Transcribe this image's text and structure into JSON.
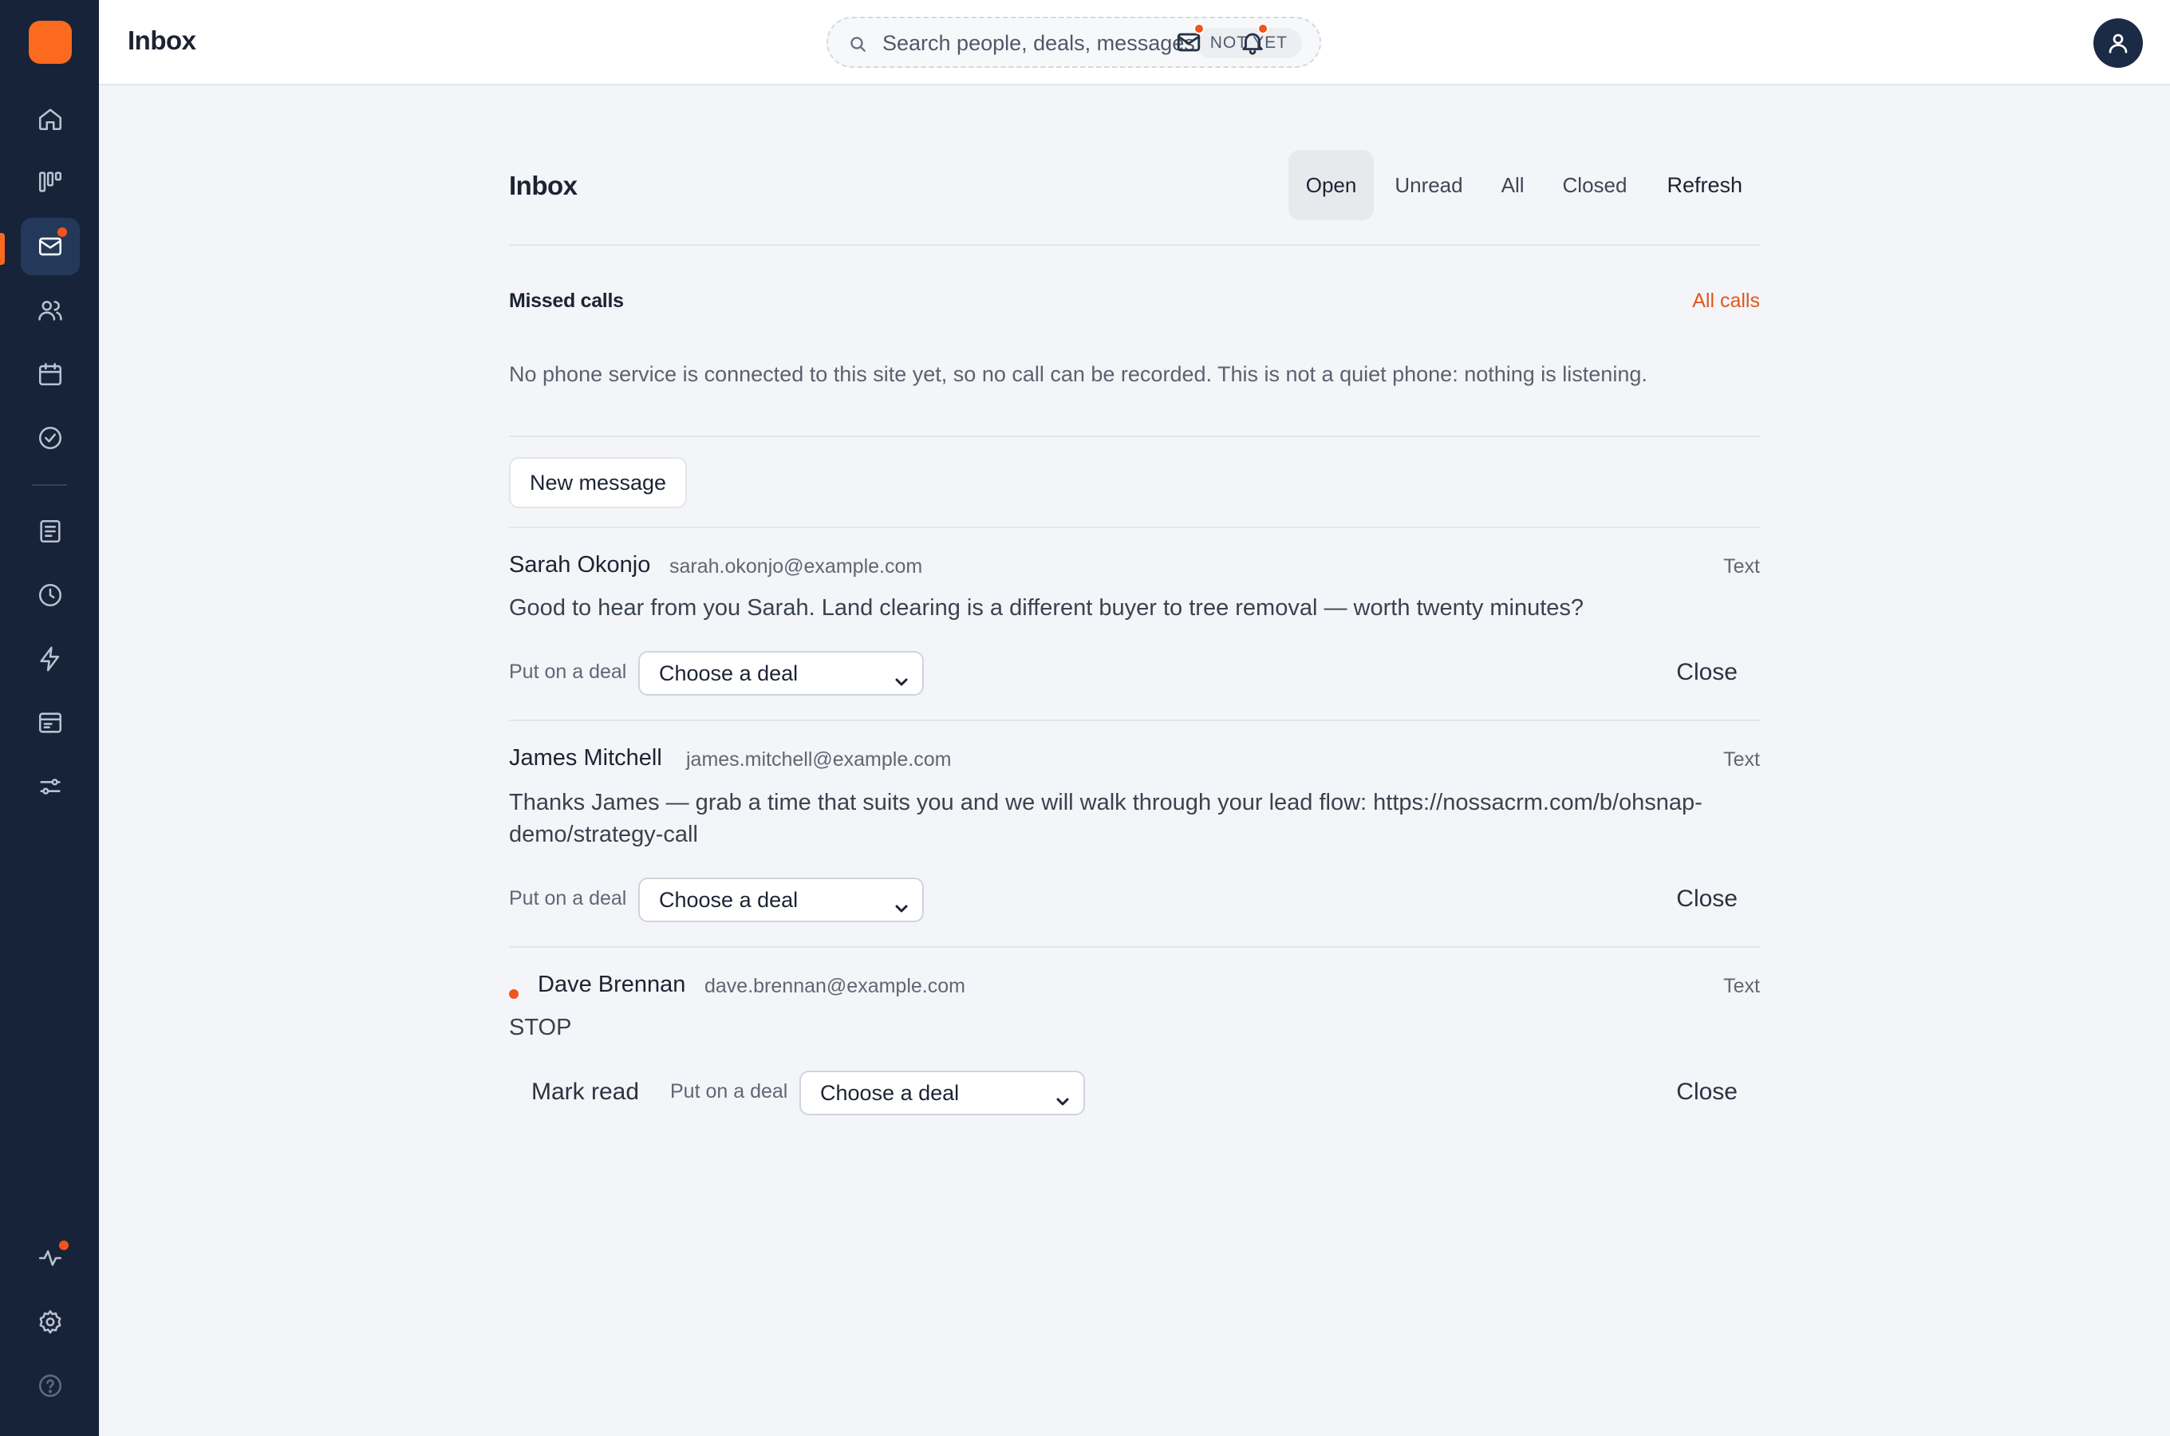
{
  "header": {
    "title": "Inbox",
    "search_placeholder": "Search people, deals, messages",
    "search_badge": "NOT YET"
  },
  "sidebar": {
    "items": [
      {
        "icon": "home-icon"
      },
      {
        "icon": "pipeline-icon"
      },
      {
        "icon": "mail-icon",
        "active": true,
        "has_dot": true
      },
      {
        "icon": "people-icon"
      },
      {
        "icon": "calendar-icon"
      },
      {
        "icon": "check-circle-icon"
      },
      {
        "icon": "document-icon"
      },
      {
        "icon": "clock-icon"
      },
      {
        "icon": "lightning-icon"
      },
      {
        "icon": "billing-icon"
      },
      {
        "icon": "sliders-icon"
      },
      {
        "icon": "activity-icon",
        "has_dot": true
      },
      {
        "icon": "gear-icon"
      },
      {
        "icon": "help-icon"
      }
    ]
  },
  "colors": {
    "accent": "#fb6a1e",
    "sidebar": "#162338",
    "dot": "#f2541b",
    "link": "#e0571d"
  },
  "inbox": {
    "title": "Inbox",
    "tabs": [
      "Open",
      "Unread",
      "All",
      "Closed"
    ],
    "active_tab": "Open",
    "refresh_label": "Refresh"
  },
  "missed_calls": {
    "title": "Missed calls",
    "link": "All calls",
    "notice": "No phone service is connected to this site yet, so no call can be recorded. This is not a quiet phone: nothing is listening."
  },
  "new_message_label": "New message",
  "messages": [
    {
      "name": "Sarah Okonjo",
      "email": "sarah.okonjo@example.com",
      "type": "Text",
      "body": "Good to hear from you Sarah. Land clearing is a different buyer to tree removal — worth twenty minutes?",
      "deal_label": "Put on a deal",
      "deal_value": "Choose a deal",
      "close_label": "Close",
      "unread": false
    },
    {
      "name": "James Mitchell",
      "email": "james.mitchell@example.com",
      "type": "Text",
      "body": "Thanks James — grab a time that suits you and we will walk through your lead flow: https://nossacrm.com/b/ohsnap-demo/strategy-call",
      "deal_label": "Put on a deal",
      "deal_value": "Choose a deal",
      "close_label": "Close",
      "unread": false
    },
    {
      "name": "Dave Brennan",
      "email": "dave.brennan@example.com",
      "type": "Text",
      "body": "STOP",
      "mark_read_label": "Mark read",
      "deal_label": "Put on a deal",
      "deal_value": "Choose a deal",
      "close_label": "Close",
      "unread": true
    }
  ]
}
